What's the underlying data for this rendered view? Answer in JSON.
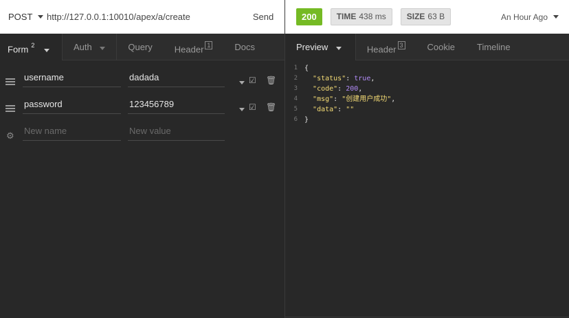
{
  "request": {
    "method": "POST",
    "url": "http://127.0.0.1:10010/apex/a/create",
    "send_label": "Send",
    "tabs": [
      {
        "label": "Form",
        "badge": "2"
      },
      {
        "label": "Auth"
      },
      {
        "label": "Query"
      },
      {
        "label": "Header",
        "badge": "1"
      },
      {
        "label": "Docs"
      }
    ],
    "params": [
      {
        "name": "username",
        "value": "dadada"
      },
      {
        "name": "password",
        "value": "123456789"
      }
    ],
    "new_name_placeholder": "New name",
    "new_value_placeholder": "New value"
  },
  "response": {
    "status": "200",
    "time_label": "TIME",
    "time_value": "438 ms",
    "size_label": "SIZE",
    "size_value": "63 B",
    "ago": "An Hour Ago",
    "tabs": [
      {
        "label": "Preview"
      },
      {
        "label": "Header",
        "badge": "3"
      },
      {
        "label": "Cookie"
      },
      {
        "label": "Timeline"
      }
    ],
    "lines": [
      {
        "n": "1",
        "t": "{"
      },
      {
        "n": "2",
        "k": "\"status\"",
        "sep": ": ",
        "v": "true",
        "vt": "b",
        "end": ","
      },
      {
        "n": "3",
        "k": "\"code\"",
        "sep": ": ",
        "v": "200",
        "vt": "b",
        "end": ","
      },
      {
        "n": "4",
        "k": "\"msg\"",
        "sep": ": ",
        "v": "\"创建用户成功\"",
        "vt": "s",
        "end": ","
      },
      {
        "n": "5",
        "k": "\"data\"",
        "sep": ": ",
        "v": "\"\"",
        "vt": "s",
        "end": ""
      },
      {
        "n": "6",
        "t": "}"
      }
    ]
  },
  "colors": {
    "status_ok": "#75ba24",
    "key": "#f5dc75",
    "bool_num": "#b18bf7"
  }
}
